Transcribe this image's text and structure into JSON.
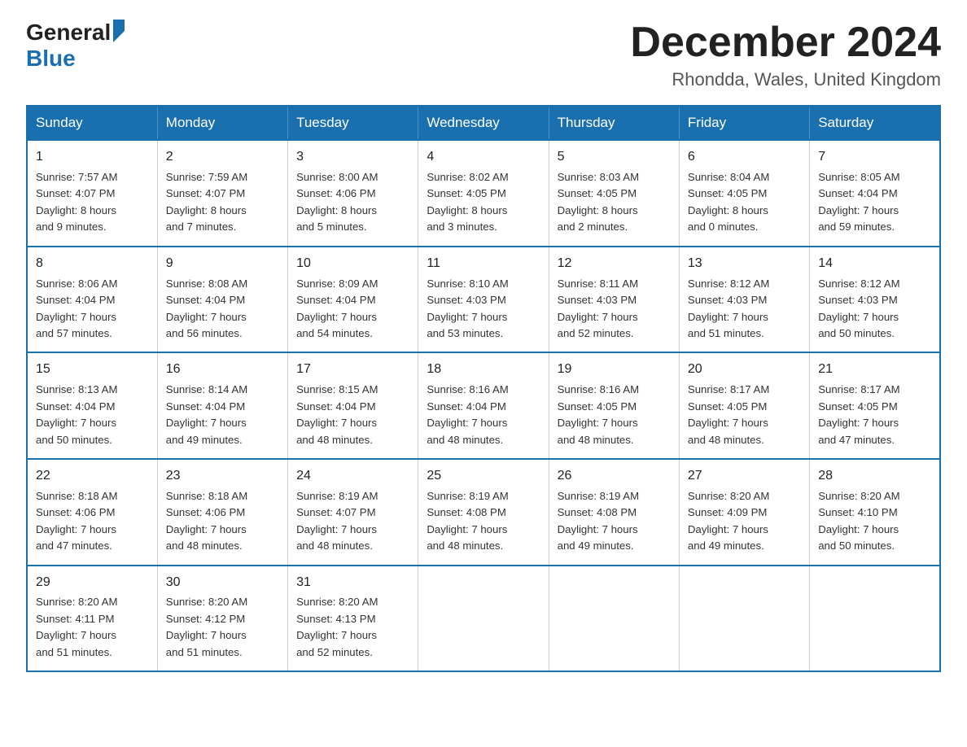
{
  "logo": {
    "general": "General",
    "blue": "Blue",
    "tagline": "GeneralBlue"
  },
  "title": "December 2024",
  "location": "Rhondda, Wales, United Kingdom",
  "days_header": [
    "Sunday",
    "Monday",
    "Tuesday",
    "Wednesday",
    "Thursday",
    "Friday",
    "Saturday"
  ],
  "weeks": [
    [
      {
        "num": "1",
        "info": "Sunrise: 7:57 AM\nSunset: 4:07 PM\nDaylight: 8 hours\nand 9 minutes."
      },
      {
        "num": "2",
        "info": "Sunrise: 7:59 AM\nSunset: 4:07 PM\nDaylight: 8 hours\nand 7 minutes."
      },
      {
        "num": "3",
        "info": "Sunrise: 8:00 AM\nSunset: 4:06 PM\nDaylight: 8 hours\nand 5 minutes."
      },
      {
        "num": "4",
        "info": "Sunrise: 8:02 AM\nSunset: 4:05 PM\nDaylight: 8 hours\nand 3 minutes."
      },
      {
        "num": "5",
        "info": "Sunrise: 8:03 AM\nSunset: 4:05 PM\nDaylight: 8 hours\nand 2 minutes."
      },
      {
        "num": "6",
        "info": "Sunrise: 8:04 AM\nSunset: 4:05 PM\nDaylight: 8 hours\nand 0 minutes."
      },
      {
        "num": "7",
        "info": "Sunrise: 8:05 AM\nSunset: 4:04 PM\nDaylight: 7 hours\nand 59 minutes."
      }
    ],
    [
      {
        "num": "8",
        "info": "Sunrise: 8:06 AM\nSunset: 4:04 PM\nDaylight: 7 hours\nand 57 minutes."
      },
      {
        "num": "9",
        "info": "Sunrise: 8:08 AM\nSunset: 4:04 PM\nDaylight: 7 hours\nand 56 minutes."
      },
      {
        "num": "10",
        "info": "Sunrise: 8:09 AM\nSunset: 4:04 PM\nDaylight: 7 hours\nand 54 minutes."
      },
      {
        "num": "11",
        "info": "Sunrise: 8:10 AM\nSunset: 4:03 PM\nDaylight: 7 hours\nand 53 minutes."
      },
      {
        "num": "12",
        "info": "Sunrise: 8:11 AM\nSunset: 4:03 PM\nDaylight: 7 hours\nand 52 minutes."
      },
      {
        "num": "13",
        "info": "Sunrise: 8:12 AM\nSunset: 4:03 PM\nDaylight: 7 hours\nand 51 minutes."
      },
      {
        "num": "14",
        "info": "Sunrise: 8:12 AM\nSunset: 4:03 PM\nDaylight: 7 hours\nand 50 minutes."
      }
    ],
    [
      {
        "num": "15",
        "info": "Sunrise: 8:13 AM\nSunset: 4:04 PM\nDaylight: 7 hours\nand 50 minutes."
      },
      {
        "num": "16",
        "info": "Sunrise: 8:14 AM\nSunset: 4:04 PM\nDaylight: 7 hours\nand 49 minutes."
      },
      {
        "num": "17",
        "info": "Sunrise: 8:15 AM\nSunset: 4:04 PM\nDaylight: 7 hours\nand 48 minutes."
      },
      {
        "num": "18",
        "info": "Sunrise: 8:16 AM\nSunset: 4:04 PM\nDaylight: 7 hours\nand 48 minutes."
      },
      {
        "num": "19",
        "info": "Sunrise: 8:16 AM\nSunset: 4:05 PM\nDaylight: 7 hours\nand 48 minutes."
      },
      {
        "num": "20",
        "info": "Sunrise: 8:17 AM\nSunset: 4:05 PM\nDaylight: 7 hours\nand 48 minutes."
      },
      {
        "num": "21",
        "info": "Sunrise: 8:17 AM\nSunset: 4:05 PM\nDaylight: 7 hours\nand 47 minutes."
      }
    ],
    [
      {
        "num": "22",
        "info": "Sunrise: 8:18 AM\nSunset: 4:06 PM\nDaylight: 7 hours\nand 47 minutes."
      },
      {
        "num": "23",
        "info": "Sunrise: 8:18 AM\nSunset: 4:06 PM\nDaylight: 7 hours\nand 48 minutes."
      },
      {
        "num": "24",
        "info": "Sunrise: 8:19 AM\nSunset: 4:07 PM\nDaylight: 7 hours\nand 48 minutes."
      },
      {
        "num": "25",
        "info": "Sunrise: 8:19 AM\nSunset: 4:08 PM\nDaylight: 7 hours\nand 48 minutes."
      },
      {
        "num": "26",
        "info": "Sunrise: 8:19 AM\nSunset: 4:08 PM\nDaylight: 7 hours\nand 49 minutes."
      },
      {
        "num": "27",
        "info": "Sunrise: 8:20 AM\nSunset: 4:09 PM\nDaylight: 7 hours\nand 49 minutes."
      },
      {
        "num": "28",
        "info": "Sunrise: 8:20 AM\nSunset: 4:10 PM\nDaylight: 7 hours\nand 50 minutes."
      }
    ],
    [
      {
        "num": "29",
        "info": "Sunrise: 8:20 AM\nSunset: 4:11 PM\nDaylight: 7 hours\nand 51 minutes."
      },
      {
        "num": "30",
        "info": "Sunrise: 8:20 AM\nSunset: 4:12 PM\nDaylight: 7 hours\nand 51 minutes."
      },
      {
        "num": "31",
        "info": "Sunrise: 8:20 AM\nSunset: 4:13 PM\nDaylight: 7 hours\nand 52 minutes."
      },
      {
        "num": "",
        "info": ""
      },
      {
        "num": "",
        "info": ""
      },
      {
        "num": "",
        "info": ""
      },
      {
        "num": "",
        "info": ""
      }
    ]
  ]
}
